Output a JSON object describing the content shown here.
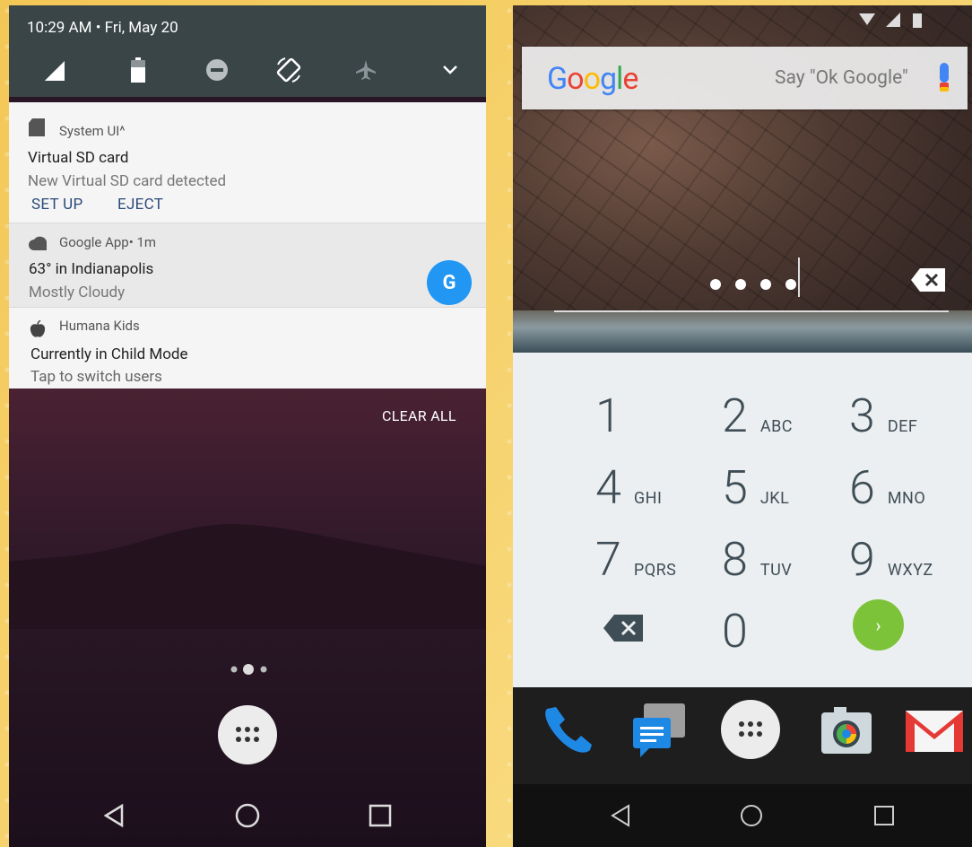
{
  "left": {
    "quick_settings": {
      "datetime": "10:29 AM • Fri, May 20"
    },
    "notifications": [
      {
        "app": "System UI^",
        "title": "Virtual SD card",
        "text": "New Virtual SD card detected",
        "actions": [
          "SET UP",
          "EJECT"
        ]
      },
      {
        "app": "Google App• 1m",
        "title": "63° in Indianapolis",
        "text": "Mostly Cloudy",
        "badge": "G"
      },
      {
        "app": "Humana Kids",
        "title": "Currently in Child Mode",
        "text": "Tap to switch users"
      }
    ],
    "clear_all": "CLEAR ALL"
  },
  "right": {
    "search": {
      "logo": "Google",
      "hint": "Say \"Ok Google\""
    },
    "keys": [
      {
        "digit": "1",
        "letters": ""
      },
      {
        "digit": "2",
        "letters": "ABC"
      },
      {
        "digit": "3",
        "letters": "DEF"
      },
      {
        "digit": "4",
        "letters": "GHI"
      },
      {
        "digit": "5",
        "letters": "JKL"
      },
      {
        "digit": "6",
        "letters": "MNO"
      },
      {
        "digit": "7",
        "letters": "PQRS"
      },
      {
        "digit": "8",
        "letters": "TUV"
      },
      {
        "digit": "9",
        "letters": "WXYZ"
      },
      {
        "digit": "0",
        "letters": ""
      }
    ],
    "enter_symbol": "›"
  },
  "colors": {
    "qs_bar": "#3a4548",
    "accent_blue": "#2196f3",
    "enter_green": "#7cc33a",
    "keypad_bg": "#eceff1",
    "keypad_text": "#3f4e56"
  }
}
